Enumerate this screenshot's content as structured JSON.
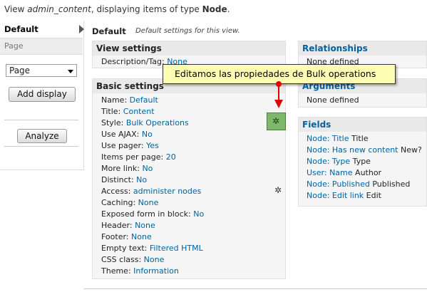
{
  "header": {
    "prefix": "View ",
    "view_name": "admin_content",
    "middle": ", displaying items of type ",
    "type": "Node",
    "suffix": "."
  },
  "left": {
    "tab_default": "Default",
    "tab_page": "Page",
    "select_value": "Page",
    "add_display": "Add display",
    "analyze": "Analyze"
  },
  "main": {
    "title": "Default",
    "description": "Default settings for this view."
  },
  "view_settings": {
    "title": "View settings",
    "desc_label": "Description/Tag: ",
    "desc_value": "None"
  },
  "basic_settings": {
    "title": "Basic settings",
    "rows": [
      {
        "label": "Name: ",
        "value": "Default"
      },
      {
        "label": "Title: ",
        "value": "Content"
      },
      {
        "label": "Style: ",
        "value": "Bulk Operations"
      },
      {
        "label": "Use AJAX: ",
        "value": "No"
      },
      {
        "label": "Use pager: ",
        "value": "Yes"
      },
      {
        "label": "Items per page: ",
        "value": "20"
      },
      {
        "label": "More link: ",
        "value": "No"
      },
      {
        "label": "Distinct: ",
        "value": "No"
      },
      {
        "label": "Access: ",
        "value": "administer nodes"
      },
      {
        "label": "Caching: ",
        "value": "None"
      },
      {
        "label": "Exposed form in block: ",
        "value": "No"
      },
      {
        "label": "Header: ",
        "value": "None"
      },
      {
        "label": "Footer: ",
        "value": "None"
      },
      {
        "label": "Empty text: ",
        "value": "Filtered HTML"
      },
      {
        "label": "CSS class: ",
        "value": "None"
      },
      {
        "label": "Theme: ",
        "value": "Information"
      }
    ]
  },
  "relationships": {
    "title": "Relationships",
    "value": "None defined"
  },
  "arguments": {
    "title": "Arguments",
    "value": "None defined"
  },
  "fields": {
    "title": "Fields",
    "rows": [
      {
        "link": "Node: Title",
        "text": " Title"
      },
      {
        "link": "Node: Has new content",
        "text": " New?"
      },
      {
        "link": "Node: Type",
        "text": " Type"
      },
      {
        "link": "User: Name",
        "text": " Author"
      },
      {
        "link": "Node: Published",
        "text": " Published"
      },
      {
        "link": "Node: Edit link",
        "text": " Edit"
      }
    ]
  },
  "tooltip": "Editamos las propiedades de Bulk operations",
  "icons": {
    "tab_arrow": "triangle-right-icon",
    "select_caret": "chevron-down-icon",
    "style_settings": "gear-icon",
    "access_settings": "gear-icon"
  },
  "colors": {
    "link": "#0062a0",
    "tooltip_bg": "#fdfdb4",
    "arrow": "#e00000",
    "gear_box": "#7db86b"
  }
}
